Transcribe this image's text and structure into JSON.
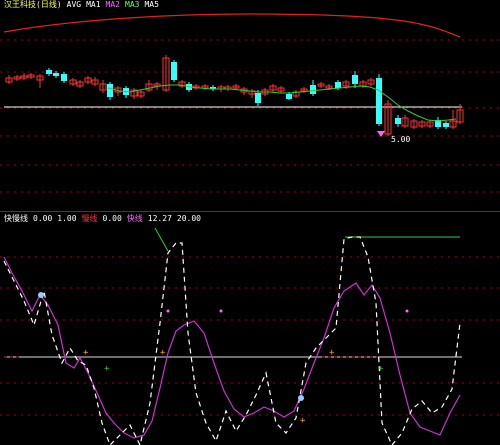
{
  "upper_panel": {
    "header_items": [
      {
        "text": "汉王科技(日线)",
        "color": "#ffff66"
      },
      {
        "text": "AVG",
        "color": "#ffffff"
      },
      {
        "text": "MA1",
        "color": "#ffffff"
      },
      {
        "text": "MA2",
        "color": "#ff66ff"
      },
      {
        "text": "MA3",
        "color": "#66ff66"
      },
      {
        "text": "MA5",
        "color": "#ffffff"
      }
    ],
    "low_price_label": "5.00"
  },
  "lower_panel": {
    "header_items": [
      {
        "text": "快慢线",
        "color": "#ffffff"
      },
      {
        "text": "0.00",
        "color": "#ffffff"
      },
      {
        "text": "1.00",
        "color": "#ffffff"
      },
      {
        "text": "慢线",
        "color": "#ff3333"
      },
      {
        "text": "0.00",
        "color": "#ffffff"
      },
      {
        "text": "快线",
        "color": "#ff66ff"
      },
      {
        "text": "12.27",
        "color": "#ffffff"
      },
      {
        "text": "20.00",
        "color": "#ffffff"
      }
    ]
  },
  "colors": {
    "background": "#000000",
    "divider": "#cc0000",
    "grid": "#aa0000",
    "up_candle": "#ff3333",
    "down_candle": "#33ffff",
    "ma_red": "#dd2222",
    "ma_green": "#33cc33",
    "white_line": "#ffffff",
    "magenta_line": "#cc33cc",
    "green_segment": "#33cc33"
  }
}
